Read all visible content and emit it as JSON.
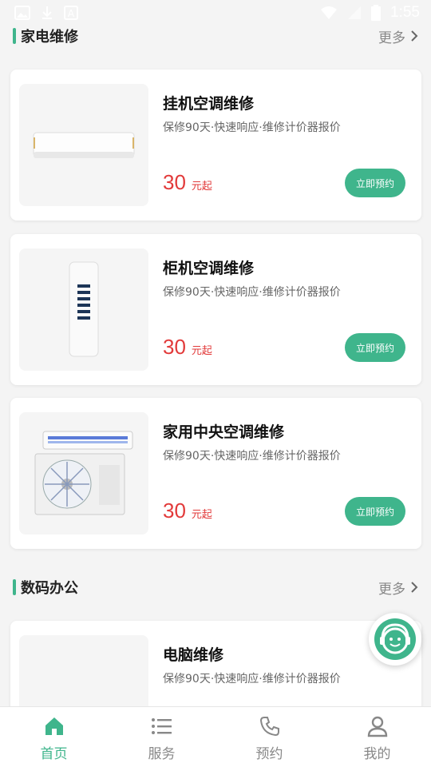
{
  "status_bar": {
    "time": "1:55"
  },
  "sections": [
    {
      "title": "家电维修",
      "more": "更多"
    },
    {
      "title": "数码办公",
      "more": "更多"
    }
  ],
  "services": [
    {
      "title": "挂机空调维修",
      "desc": "保修90天·快速响应·维修计价器报价",
      "price": "30",
      "unit": "元起",
      "button": "立即预约"
    },
    {
      "title": "柜机空调维修",
      "desc": "保修90天·快速响应·维修计价器报价",
      "price": "30",
      "unit": "元起",
      "button": "立即预约"
    },
    {
      "title": "家用中央空调维修",
      "desc": "保修90天·快速响应·维修计价器报价",
      "price": "30",
      "unit": "元起",
      "button": "立即预约"
    },
    {
      "title": "电脑维修",
      "desc": "保修90天·快速响应·维修计价器报价"
    }
  ],
  "tabs": [
    {
      "label": "首页",
      "icon": "home-icon",
      "active": true
    },
    {
      "label": "服务",
      "icon": "list-icon",
      "active": false
    },
    {
      "label": "预约",
      "icon": "phone-icon",
      "active": false
    },
    {
      "label": "我的",
      "icon": "user-icon",
      "active": false
    }
  ],
  "colors": {
    "accent": "#3fb58c",
    "price": "#e23a3a"
  }
}
